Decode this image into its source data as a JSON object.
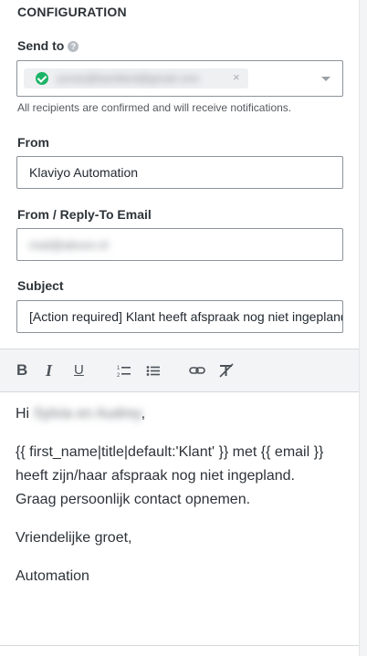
{
  "section": {
    "title": "CONFIGURATION"
  },
  "send_to": {
    "label": "Send to",
    "recipient_email": "yonas@banillard@gmail.com",
    "hint": "All recipients are confirmed and will receive notifications."
  },
  "from": {
    "label": "From",
    "value": "Klaviyo Automation"
  },
  "reply_to": {
    "label": "From / Reply-To Email",
    "value": "mail@abvon.nl"
  },
  "subject": {
    "label": "Subject",
    "value": "[Action required] Klant heeft afspraak nog niet ingepland"
  },
  "editor": {
    "greeting_prefix": "Hi ",
    "greeting_name": "Sylvia en Audrey",
    "greeting_suffix": ",",
    "paragraph1": "{{ first_name|title|default:'Klant' }} met {{ email }} heeft zijn/haar afspraak nog niet ingepland. Graag persoonlijk contact opnemen.",
    "paragraph2": "Vriendelijke groet,",
    "paragraph3": "Automation"
  },
  "toolbar": {
    "bold": "B",
    "italic": "I",
    "underline": "U"
  },
  "icons": [
    "help-icon",
    "check-circle-icon",
    "close-icon",
    "chevron-down-icon",
    "ordered-list-icon",
    "bullet-list-icon",
    "link-icon",
    "clear-format-icon"
  ]
}
